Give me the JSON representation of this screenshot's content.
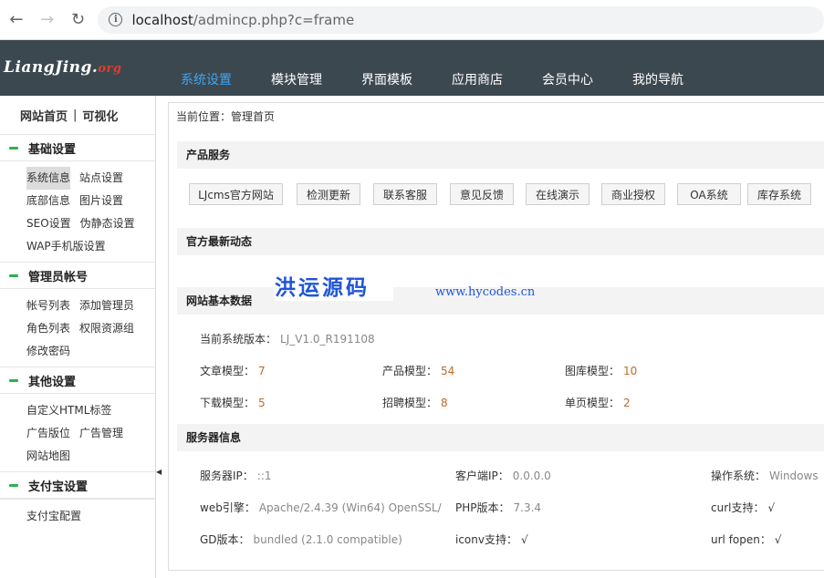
{
  "browser": {
    "url_host": "localhost",
    "url_path": "/admincp.php?c=frame"
  },
  "logo": {
    "main": "LiangJing.",
    "org": "org"
  },
  "topnav": [
    {
      "label": "系统设置",
      "active": true
    },
    {
      "label": "模块管理"
    },
    {
      "label": "界面模板"
    },
    {
      "label": "应用商店"
    },
    {
      "label": "会员中心"
    },
    {
      "label": "我的导航"
    }
  ],
  "sidebar": {
    "home": "网站首页",
    "separator": "|",
    "visual": "可视化",
    "groups": [
      {
        "title": "基础设置",
        "items": [
          "系统信息",
          "站点设置",
          "底部信息",
          "图片设置",
          "SEO设置",
          "伪静态设置",
          "WAP手机版设置"
        ]
      },
      {
        "title": "管理员帐号",
        "items": [
          "帐号列表",
          "添加管理员",
          "角色列表",
          "权限资源组",
          "修改密码"
        ]
      },
      {
        "title": "其他设置",
        "items": [
          "自定义HTML标签",
          "广告版位",
          "广告管理",
          "网站地图"
        ]
      },
      {
        "title": "支付宝设置",
        "items": [
          "支付宝配置"
        ]
      }
    ]
  },
  "main": {
    "breadcrumb": "当前位置：管理首页",
    "sections": {
      "products": "产品服务",
      "news": "官方最新动态",
      "basic": "网站基本数据",
      "server": "服务器信息"
    },
    "service_buttons": [
      "LJcms官方网站",
      "检测更新",
      "联系客服",
      "意见反馈",
      "在线演示",
      "商业授权",
      "OA系统",
      "库存系统"
    ],
    "watermark": {
      "text": "洪运源码",
      "url": "www.hycodes.cn"
    },
    "version": {
      "label": "当前系统版本：",
      "value": "LJ_V1.0_R191108"
    },
    "models": [
      {
        "label": "文章模型：",
        "value": "7"
      },
      {
        "label": "产品模型：",
        "value": "54"
      },
      {
        "label": "图库模型：",
        "value": "10"
      },
      {
        "label": "下载模型：",
        "value": "5"
      },
      {
        "label": "招聘模型：",
        "value": "8"
      },
      {
        "label": "单页模型：",
        "value": "2"
      }
    ],
    "server_info": [
      {
        "label": "服务器IP：",
        "value": "::1"
      },
      {
        "label": "客户端IP：",
        "value": "0.0.0.0"
      },
      {
        "label": "操作系统：",
        "value": "Windows"
      },
      {
        "label": "web引擎：",
        "value": "Apache/2.4.39 (Win64) OpenSSL/"
      },
      {
        "label": "PHP版本：",
        "value": "7.3.4"
      },
      {
        "label": "curl支持：",
        "value": "√"
      },
      {
        "label": "GD版本：",
        "value": "bundled (2.1.0 compatible)"
      },
      {
        "label": "iconv支持：",
        "value": "√"
      },
      {
        "label": "url fopen：",
        "value": "√"
      }
    ]
  },
  "colors": {
    "header_bg": "#3c4850",
    "nav_active": "#3fa5f0",
    "group_marker": "#2bb24c",
    "watermark": "#1f55d6"
  }
}
